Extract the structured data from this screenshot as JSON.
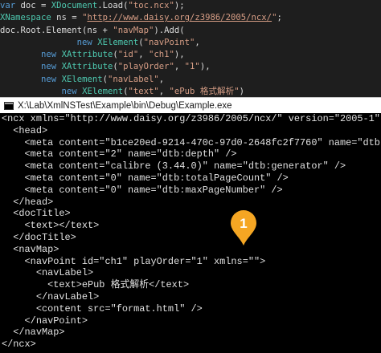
{
  "editor": {
    "lines": [
      [
        {
          "t": "var",
          "c": "kw"
        },
        {
          "t": " doc = ",
          "c": "id"
        },
        {
          "t": "XDocument",
          "c": "type"
        },
        {
          "t": ".Load(",
          "c": "id"
        },
        {
          "t": "\"toc.ncx\"",
          "c": "str"
        },
        {
          "t": ");",
          "c": "id"
        }
      ],
      [
        {
          "t": "XNamespace",
          "c": "type"
        },
        {
          "t": " ns = ",
          "c": "id"
        },
        {
          "t": "\"",
          "c": "str"
        },
        {
          "t": "http://www.daisy.org/z3986/2005/ncx/",
          "c": "url"
        },
        {
          "t": "\"",
          "c": "str"
        },
        {
          "t": ";",
          "c": "id"
        }
      ],
      [
        {
          "t": "doc.Root.Element(ns + ",
          "c": "id"
        },
        {
          "t": "\"navMap\"",
          "c": "str"
        },
        {
          "t": ").Add(",
          "c": "id"
        }
      ],
      [
        {
          "t": "               ",
          "c": "id"
        },
        {
          "t": "new",
          "c": "kw"
        },
        {
          "t": " ",
          "c": "id"
        },
        {
          "t": "XElement",
          "c": "type"
        },
        {
          "t": "(",
          "c": "id"
        },
        {
          "t": "\"navPoint\"",
          "c": "str"
        },
        {
          "t": ",",
          "c": "id"
        }
      ],
      [
        {
          "t": "        ",
          "c": "id"
        },
        {
          "t": "new",
          "c": "kw"
        },
        {
          "t": " ",
          "c": "id"
        },
        {
          "t": "XAttribute",
          "c": "type"
        },
        {
          "t": "(",
          "c": "id"
        },
        {
          "t": "\"id\"",
          "c": "str"
        },
        {
          "t": ", ",
          "c": "id"
        },
        {
          "t": "\"ch1\"",
          "c": "str"
        },
        {
          "t": "),",
          "c": "id"
        }
      ],
      [
        {
          "t": "        ",
          "c": "id"
        },
        {
          "t": "new",
          "c": "kw"
        },
        {
          "t": " ",
          "c": "id"
        },
        {
          "t": "XAttribute",
          "c": "type"
        },
        {
          "t": "(",
          "c": "id"
        },
        {
          "t": "\"playOrder\"",
          "c": "str"
        },
        {
          "t": ", ",
          "c": "id"
        },
        {
          "t": "\"1\"",
          "c": "str"
        },
        {
          "t": "),",
          "c": "id"
        }
      ],
      [
        {
          "t": "        ",
          "c": "id"
        },
        {
          "t": "new",
          "c": "kw"
        },
        {
          "t": " ",
          "c": "id"
        },
        {
          "t": "XElement",
          "c": "type"
        },
        {
          "t": "(",
          "c": "id"
        },
        {
          "t": "\"navLabel\"",
          "c": "str"
        },
        {
          "t": ",",
          "c": "id"
        }
      ],
      [
        {
          "t": "            ",
          "c": "id"
        },
        {
          "t": "new",
          "c": "kw"
        },
        {
          "t": " ",
          "c": "id"
        },
        {
          "t": "XElement",
          "c": "type"
        },
        {
          "t": "(",
          "c": "id"
        },
        {
          "t": "\"text\"",
          "c": "str"
        },
        {
          "t": ", ",
          "c": "id"
        },
        {
          "t": "\"ePub 格式解析\"",
          "c": "str"
        },
        {
          "t": ")",
          "c": "id"
        }
      ]
    ]
  },
  "console": {
    "title": "X:\\Lab\\XmlNSTest\\Example\\bin\\Debug\\Example.exe",
    "lines": [
      "<ncx xmlns=\"http://www.daisy.org/z3986/2005/ncx/\" version=\"2005-1\"",
      "  <head>",
      "    <meta content=\"b1ce20ed-9214-470c-97d0-2648fc2f7760\" name=\"dtb:",
      "    <meta content=\"2\" name=\"dtb:depth\" />",
      "    <meta content=\"calibre (3.44.0)\" name=\"dtb:generator\" />",
      "    <meta content=\"0\" name=\"dtb:totalPageCount\" />",
      "    <meta content=\"0\" name=\"dtb:maxPageNumber\" />",
      "  </head>",
      "  <docTitle>",
      "    <text></text>",
      "  </docTitle>",
      "  <navMap>",
      "    <navPoint id=\"ch1\" playOrder=\"1\" xmlns=\"\">",
      "      <navLabel>",
      "        <text>ePub 格式解析</text>",
      "      </navLabel>",
      "      <content src=\"format.html\" />",
      "    </navPoint>",
      "  </navMap>",
      "</ncx>"
    ]
  },
  "callout": {
    "label": "1",
    "color": "#f5a623"
  },
  "colors": {
    "editor_bg": "#1e1e1e",
    "console_bg": "#000000",
    "keyword": "#569cd6",
    "type": "#4ec9b0",
    "string": "#d69d85"
  }
}
